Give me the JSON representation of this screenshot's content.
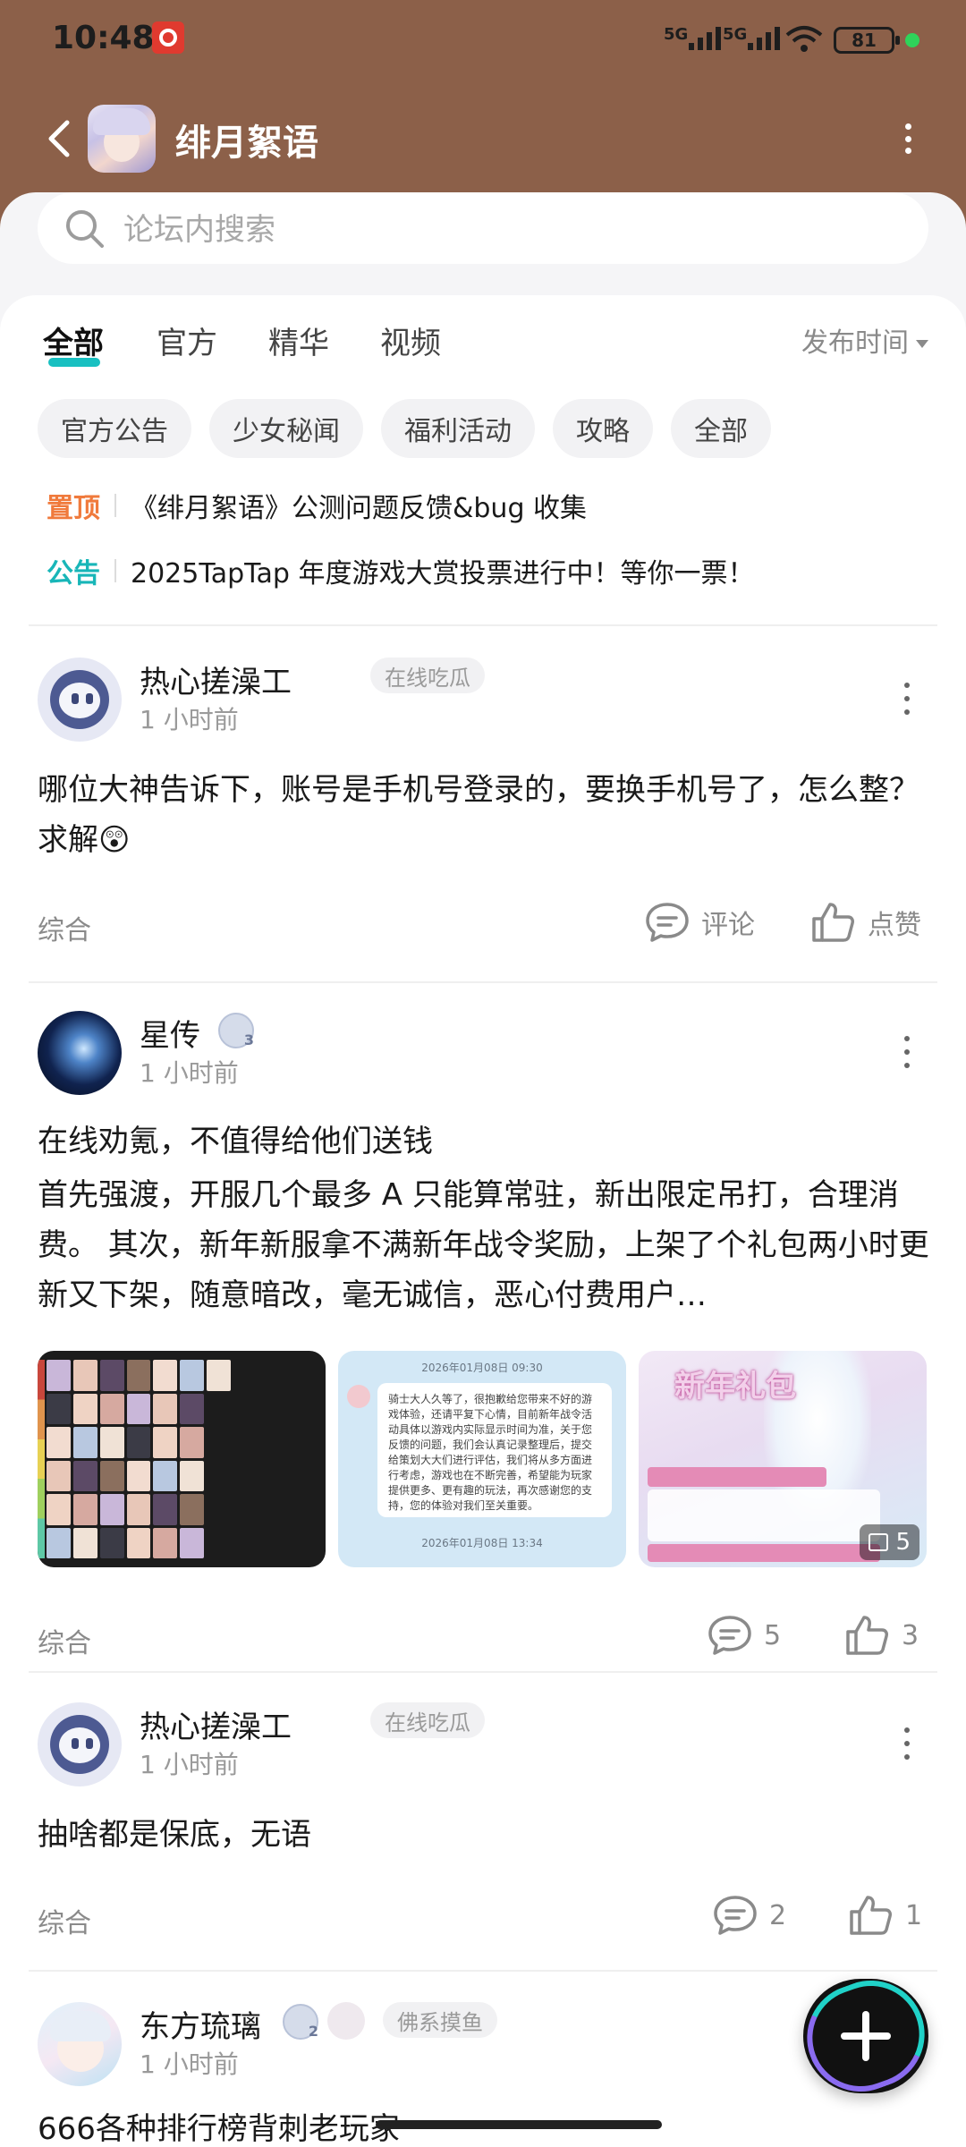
{
  "status": {
    "time": "10:48",
    "net1": "5G",
    "net2": "5G",
    "battery": "81"
  },
  "nav": {
    "title": "绯月絮语"
  },
  "search": {
    "placeholder": "论坛内搜索"
  },
  "tabs": [
    {
      "label": "全部",
      "active": true
    },
    {
      "label": "官方"
    },
    {
      "label": "精华"
    },
    {
      "label": "视频"
    }
  ],
  "sort": {
    "label": "发布时间"
  },
  "chips": [
    "官方公告",
    "少女秘闻",
    "福利活动",
    "攻略",
    "全部"
  ],
  "pinned": [
    {
      "tag": "置顶",
      "text": "《绯月絮语》公测问题反馈&bug 收集",
      "color": "#f07a3c"
    },
    {
      "tag": "公告",
      "text": "2025TapTap 年度游戏大赏投票进行中！等你一票！",
      "color": "#18b6b8"
    }
  ],
  "posts": [
    {
      "user": "热心搓澡工",
      "time": "1 小时前",
      "badge": "在线吃瓜",
      "body": "哪位大神告诉下，账号是手机号登录的，要换手机号了，怎么整？求解😲",
      "tag": "综合",
      "comment": "评论",
      "like": "点赞"
    },
    {
      "user": "星传",
      "level": "3",
      "time": "1 小时前",
      "title": "在线劝氪，不值得给他们送钱",
      "body": "首先强渡，开服几个最多 A 只能算常驻，新出限定吊打，合理消费。 其次，新年新服拿不满新年战令奖励，上架了个礼包两小时更新又下架，随意暗改，毫无诚信，恶心付费用户…",
      "images": {
        "chat_date1": "2026年01月08日 09:30",
        "chat_text": "骑士大人久等了，很抱歉给您带来不好的游戏体验，还请平复下心情，目前新年战令活动具体以游戏内实际显示时间为准，关于您反馈的问题，我们会认真记录整理后，提交给策划大大们进行评估，我们将从多方面进行考虑，游戏也在不断完善，希望能为玩家提供更多、更有趣的玩法，再次感谢您的支持，您的体验对我们至关重要。",
        "chat_date2": "2026年01月08日 13:34",
        "gift_title": "新年礼包",
        "more_count": "5"
      },
      "tag": "综合",
      "comment": "5",
      "like": "3"
    },
    {
      "user": "热心搓澡工",
      "time": "1 小时前",
      "badge": "在线吃瓜",
      "body": "抽啥都是保底，无语",
      "tag": "综合",
      "comment": "2",
      "like": "1"
    },
    {
      "user": "东方琉璃",
      "level": "2",
      "time": "1 小时前",
      "badge": "佛系摸鱼",
      "body": "666各种排行榜背刺老玩家"
    }
  ]
}
